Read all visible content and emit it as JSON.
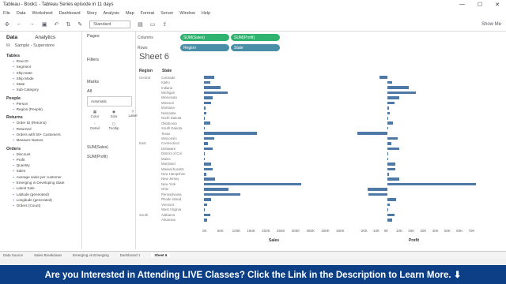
{
  "window": {
    "title": "Tableau - Book1 - Tableau Series episode in 11 days",
    "minimize": "—",
    "maximize": "☐",
    "close": "✕"
  },
  "menu": [
    "File",
    "Data",
    "Worksheet",
    "Dashboard",
    "Story",
    "Analysis",
    "Map",
    "Format",
    "Server",
    "Window",
    "Help"
  ],
  "toolbar": {
    "fit": "Standard",
    "show_me": "Show Me"
  },
  "data_pane": {
    "tabs": [
      "Data",
      "Analytics"
    ],
    "source": [
      "Sample - Superstore"
    ],
    "tables_header": "Tables",
    "items_top": [
      "Row ID",
      "Segment",
      "Ship Date",
      "Ship Mode",
      "State",
      "Sub-Category"
    ],
    "people_header": "People",
    "people_items": [
      "Person",
      "Region (People)"
    ],
    "returns_header": "Returns",
    "returns_items": [
      "Order ID (Returns)",
      "Returned"
    ],
    "misc_items": [
      "Orders with 50+ Customers",
      "Measure Names"
    ],
    "orders_header": "Orders",
    "orders_items": [
      "Discount",
      "Profit",
      "Quantity",
      "Sales",
      "Average sales per customer",
      "Emerging in Developing State",
      "Latest Sale",
      "Latitude (generated)",
      "Longitude (generated)",
      "Orders (Count)"
    ]
  },
  "pages_pane": {
    "pages": "Pages",
    "filters": "Filters",
    "marks": "Marks",
    "all": "All",
    "automatic": "Automatic",
    "buttons": [
      "Color",
      "Size",
      "Label",
      "Detail",
      "Tooltip"
    ],
    "measure_sales": "SUM(Sales)",
    "measure_profit": "SUM(Profit)"
  },
  "shelves": {
    "columns_label": "Columns",
    "rows_label": "Rows",
    "columns": [
      "SUM(Sales)",
      "SUM(Profit)"
    ],
    "rows": [
      "Region",
      "State"
    ]
  },
  "sheet": {
    "title": "Sheet 6",
    "region_header": "Region",
    "state_header": "State"
  },
  "chart_data": {
    "type": "bar",
    "categories": [
      "Colorado",
      "Idaho",
      "Indiana",
      "Michigan",
      "Minnesota",
      "Missouri",
      "Montana",
      "Nebraska",
      "North Dakota",
      "Oklahoma",
      "South Dakota",
      "Texas",
      "Wisconsin",
      "Connecticut",
      "Delaware",
      "District of Col.",
      "Maine",
      "Maryland",
      "Massachusetts",
      "New Hampshire",
      "New Jersey",
      "New York",
      "Ohio",
      "Pennsylvania",
      "Rhode Island",
      "Vermont",
      "West Virginia",
      "Alabama",
      "Arkansas"
    ],
    "regions": [
      "Central",
      "East",
      "South"
    ],
    "region_starts": [
      0,
      13,
      27
    ],
    "series": [
      {
        "name": "Sales",
        "values": [
          32000,
          21000,
          53000,
          76000,
          29000,
          22000,
          5000,
          7500,
          900,
          19000,
          1300,
          170000,
          32000,
          13000,
          27000,
          2900,
          1300,
          24000,
          28000,
          7300,
          35000,
          310000,
          78000,
          117000,
          22000,
          9000,
          1200,
          19000,
          11000
        ]
      },
      {
        "name": "Profit",
        "values": [
          -6500,
          4000,
          18000,
          24000,
          10000,
          6400,
          1800,
          2000,
          230,
          4800,
          400,
          -25000,
          8400,
          3500,
          9900,
          1000,
          450,
          7000,
          7000,
          1700,
          9800,
          74000,
          -16000,
          -15500,
          7300,
          2200,
          180,
          5800,
          4000
        ]
      }
    ],
    "sales_ticks": [
      "0K",
      "50K",
      "100K",
      "150K",
      "200K",
      "250K",
      "300K",
      "350K",
      "400K",
      "450K"
    ],
    "profit_ticks": [
      "-20K",
      "-10K",
      "0K",
      "10K",
      "20K",
      "30K",
      "40K",
      "50K",
      "60K",
      "70K"
    ],
    "sales_xlim": [
      0,
      450000
    ],
    "profit_xlim": [
      -30000,
      75000
    ],
    "xlabel_sales": "Sales",
    "xlabel_profit": "Profit",
    "bar_color": "#4e79a7"
  },
  "tabs": [
    "Data Source",
    "Sales Breakdown",
    "Emerging vs Emerging",
    "Dashboard 1",
    "Sheet 6"
  ],
  "banner": "Are you Interested in Attending LIVE Classes? Click the Link in the Description to Learn More. ⬇"
}
